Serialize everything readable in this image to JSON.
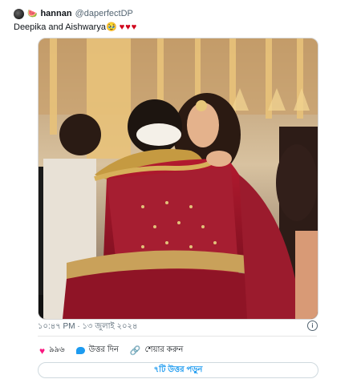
{
  "tweet": {
    "display_name": "hannan",
    "handle": "@daperfectDP",
    "text": "Deepika and Aishwarya",
    "emoji": "🥹",
    "hearts": "♥♥♥",
    "timestamp": "১০:৪৭ PM · ১৩ জুলাই ২০২৪"
  },
  "actions": {
    "like_count": "৯৯৬",
    "reply_label": "উত্তর দিন",
    "share_label": "শেয়ার করুন"
  },
  "replies_button": "৭টি উত্তর পড়ুন",
  "icons": {
    "like": "heart-icon",
    "reply": "speech-bubble-icon",
    "share": "link-icon",
    "info": "info-icon"
  },
  "colors": {
    "accent": "#1d9bf0",
    "like": "#f91880"
  }
}
